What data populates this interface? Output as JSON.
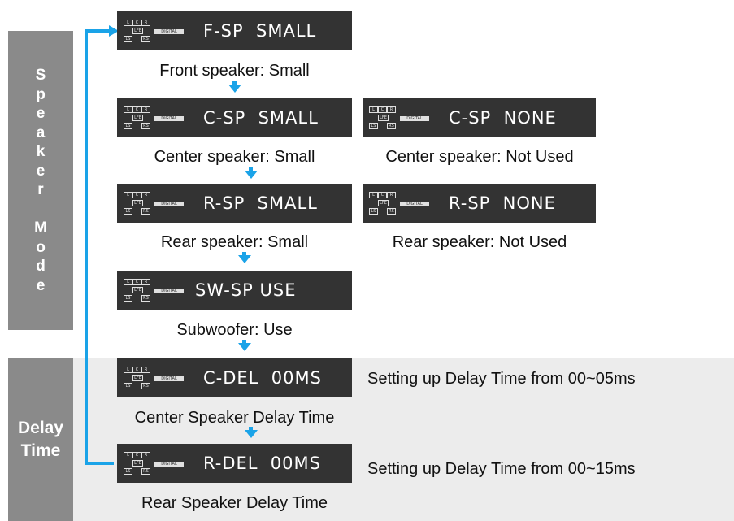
{
  "side": {
    "mode_letters": [
      "S",
      "p",
      "e",
      "a",
      "k",
      "e",
      "r",
      "",
      "M",
      "o",
      "d",
      "e"
    ],
    "delay_line1": "Delay",
    "delay_line2": "Time"
  },
  "indicator": {
    "l": "L",
    "c": "C",
    "r": "R",
    "lfe": "LFE",
    "ls": "LS",
    "rs": "RS",
    "digital": "DIGITAL"
  },
  "displays": {
    "fsp": {
      "text": "F-SP  SMALL",
      "caption": "Front speaker: Small"
    },
    "csp_small": {
      "text": "C-SP  SMALL",
      "caption": "Center speaker: Small"
    },
    "csp_none": {
      "text": "C-SP  NONE",
      "caption": "Center speaker: Not Used"
    },
    "rsp_small": {
      "text": "R-SP  SMALL",
      "caption": "Rear speaker: Small"
    },
    "rsp_none": {
      "text": "R-SP  NONE",
      "caption": "Rear speaker: Not Used"
    },
    "sw": {
      "text": "SW-SP USE",
      "caption": "Subwoofer: Use"
    },
    "cdel": {
      "text": "C-DEL  00MS",
      "caption": "Center Speaker Delay Time",
      "note": "Setting up Delay Time from 00~05ms"
    },
    "rdel": {
      "text": "R-DEL  00MS",
      "caption": "Rear Speaker Delay Time",
      "note": "Setting up Delay Time from 00~15ms"
    }
  },
  "colors": {
    "accent": "#1aa3e8",
    "side_panel": "#8a8a8a",
    "lcd": "#333333",
    "delay_bg": "#ececec"
  }
}
